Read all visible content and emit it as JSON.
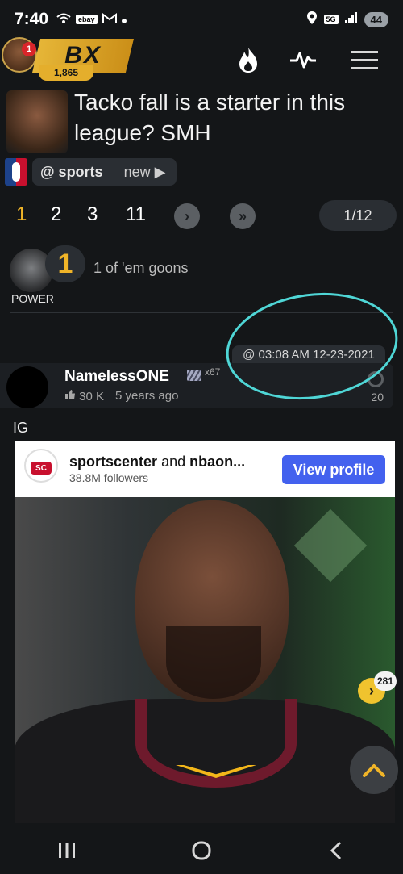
{
  "status_bar": {
    "time": "7:40",
    "left_icons": [
      "wifi-icon",
      "ebay-icon",
      "gmail-icon",
      "dot-icon"
    ],
    "ebay_label": "ebay",
    "network": "5G",
    "battery": "44"
  },
  "header": {
    "logo": "BX",
    "points": "1,865",
    "notification_count": "1",
    "icons": [
      "fire-icon",
      "activity-icon",
      "menu-icon"
    ]
  },
  "post": {
    "title": "Tacko fall is a starter in this league? SMH",
    "category": "@ sports",
    "new_label": "new ▶"
  },
  "pager": {
    "pages": [
      "1",
      "2",
      "3",
      "11"
    ],
    "current": "1",
    "next": "›",
    "last": "»",
    "count": "1/12"
  },
  "op": {
    "rank": "1",
    "tagline": "1 of 'em goons",
    "power_label": "POWER"
  },
  "reply": {
    "timestamp": "@ 03:08 AM 12-23-2021",
    "username": "NamelessONE",
    "multiplier": "x67",
    "likes": "30 K",
    "age": "5 years ago",
    "reply_count": "20"
  },
  "embed": {
    "label": "IG",
    "account": "sportscenter",
    "and_text": "and",
    "account2": "nbaon...",
    "followers": "38.8M followers",
    "button": "View profile",
    "logo_text": "SC"
  },
  "fab": {
    "comment_count": "281",
    "scroll_top_icon": "chevron-up-icon"
  },
  "nav": {
    "recent": "|||",
    "home": "○",
    "back": "‹"
  },
  "colors": {
    "background": "#141618",
    "accent_gold": "#f0b428",
    "annotation": "#4fd6d6",
    "button_blue": "#4361ee"
  }
}
